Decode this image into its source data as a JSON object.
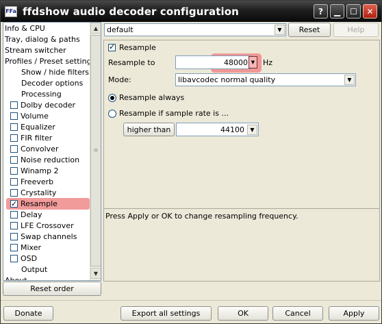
{
  "window": {
    "title": "ffdshow audio decoder configuration",
    "app_icon_text": "FFa"
  },
  "tree": {
    "items": [
      {
        "label": "Info & CPU",
        "indent": 0,
        "checkbox": false
      },
      {
        "label": "Tray, dialog & paths",
        "indent": 0,
        "checkbox": false
      },
      {
        "label": "Stream switcher",
        "indent": 0,
        "checkbox": false
      },
      {
        "label": "Profiles / Preset settings",
        "indent": 0,
        "checkbox": false
      },
      {
        "label": "Show / hide filters",
        "indent": 2,
        "checkbox": false
      },
      {
        "label": "Decoder options",
        "indent": 2,
        "checkbox": false
      },
      {
        "label": "Processing",
        "indent": 2,
        "checkbox": false
      },
      {
        "label": "Dolby decoder",
        "indent": 1,
        "checkbox": true,
        "checked": false
      },
      {
        "label": "Volume",
        "indent": 1,
        "checkbox": true,
        "checked": false
      },
      {
        "label": "Equalizer",
        "indent": 1,
        "checkbox": true,
        "checked": false
      },
      {
        "label": "FIR filter",
        "indent": 1,
        "checkbox": true,
        "checked": false
      },
      {
        "label": "Convolver",
        "indent": 1,
        "checkbox": true,
        "checked": false
      },
      {
        "label": "Noise reduction",
        "indent": 1,
        "checkbox": true,
        "checked": false
      },
      {
        "label": "Winamp 2",
        "indent": 1,
        "checkbox": true,
        "checked": false
      },
      {
        "label": "Freeverb",
        "indent": 1,
        "checkbox": true,
        "checked": false
      },
      {
        "label": "Crystality",
        "indent": 1,
        "checkbox": true,
        "checked": false
      },
      {
        "label": "Resample",
        "indent": 1,
        "checkbox": true,
        "checked": true
      },
      {
        "label": "Delay",
        "indent": 1,
        "checkbox": true,
        "checked": false
      },
      {
        "label": "LFE Crossover",
        "indent": 1,
        "checkbox": true,
        "checked": false
      },
      {
        "label": "Swap channels",
        "indent": 1,
        "checkbox": true,
        "checked": false
      },
      {
        "label": "Mixer",
        "indent": 1,
        "checkbox": true,
        "checked": false
      },
      {
        "label": "OSD",
        "indent": 1,
        "checkbox": true,
        "checked": false
      },
      {
        "label": "Output",
        "indent": 2,
        "checkbox": false
      },
      {
        "label": "About",
        "indent": 0,
        "checkbox": false
      }
    ],
    "reset_order_label": "Reset order"
  },
  "preset": {
    "selected": "default",
    "reset_label": "Reset",
    "help_label": "Help"
  },
  "resample": {
    "enable_label": "Resample",
    "enabled": true,
    "resample_to_label": "Resample to",
    "resample_to_value": "48000",
    "unit": "Hz",
    "mode_label": "Mode:",
    "mode_value": "libavcodec normal quality",
    "always_label": "Resample always",
    "if_label": "Resample if sample rate is ...",
    "condition_label": "higher than",
    "condition_value": "44100"
  },
  "description": "Press Apply or OK to change resampling frequency.",
  "footer": {
    "donate": "Donate",
    "export": "Export all settings",
    "ok": "OK",
    "cancel": "Cancel",
    "apply": "Apply"
  }
}
